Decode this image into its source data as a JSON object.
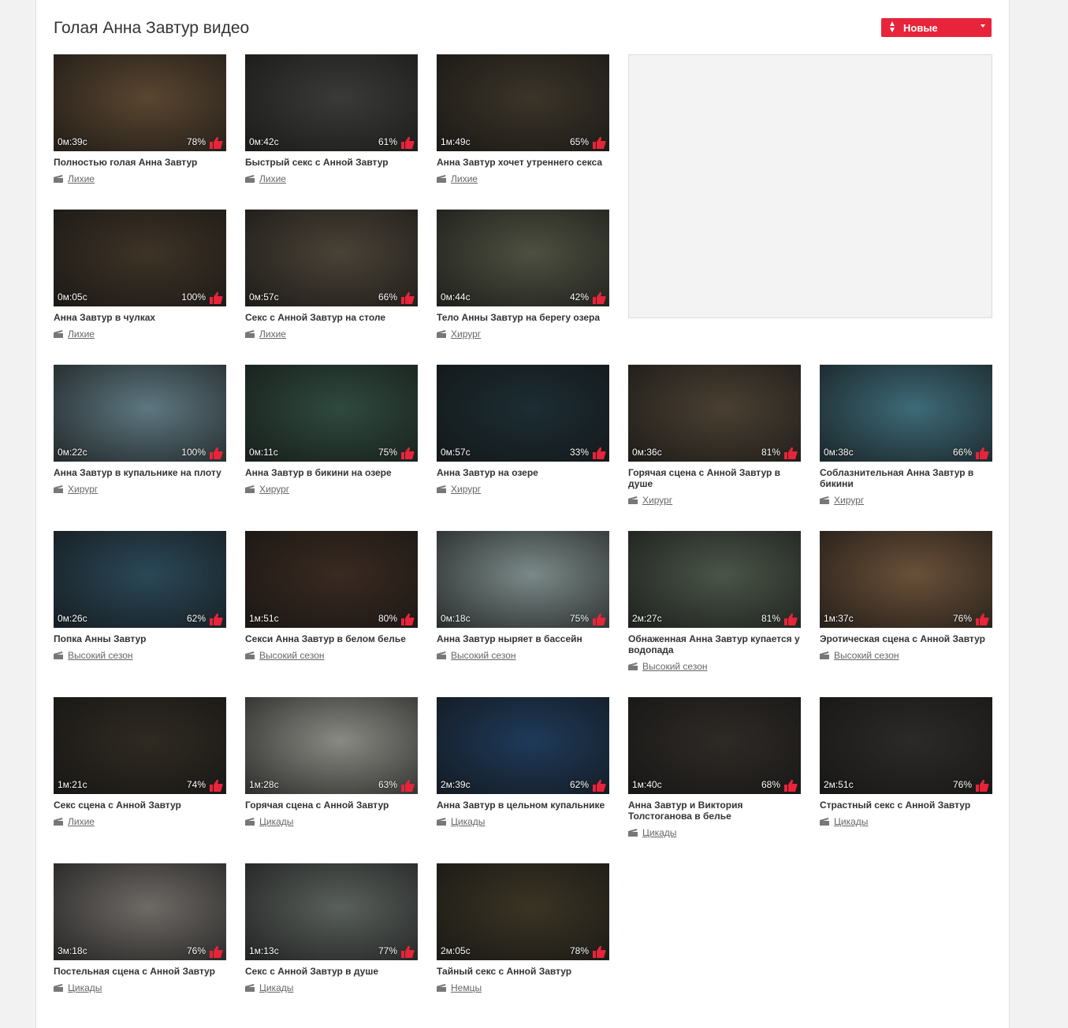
{
  "header": {
    "title": "Голая Анна Завтур видео",
    "sort_label": "Новые"
  },
  "colors": {
    "accent": "#e8243a"
  },
  "videos": [
    {
      "duration": "0м:39с",
      "rating": "78%",
      "title": "Полностью голая Анна Завтур",
      "category": "Лихие",
      "thumb_color": "#5a4630"
    },
    {
      "duration": "0м:42с",
      "rating": "61%",
      "title": "Быстрый секс с Анной Завтур",
      "category": "Лихие",
      "thumb_color": "#3a3a38"
    },
    {
      "duration": "1м:49с",
      "rating": "65%",
      "title": "Анна Завтур хочет утреннего секса",
      "category": "Лихие",
      "thumb_color": "#3b3428"
    },
    {
      "duration": "0м:05с",
      "rating": "100%",
      "title": "Анна Завтур в чулках",
      "category": "Лихие",
      "thumb_color": "#3e3326"
    },
    {
      "duration": "0м:57с",
      "rating": "66%",
      "title": "Секс с Анной Завтур на столе",
      "category": "Лихие",
      "thumb_color": "#4a4236"
    },
    {
      "duration": "0м:44с",
      "rating": "42%",
      "title": "Тело Анны Завтур на берегу озера",
      "category": "Хирург",
      "thumb_color": "#4e5040"
    },
    {
      "duration": "0м:22с",
      "rating": "100%",
      "title": "Анна Завтур в купальнике на плоту",
      "category": "Хирург",
      "thumb_color": "#5d7780"
    },
    {
      "duration": "0м:11с",
      "rating": "75%",
      "title": "Анна Завтур в бикини на озере",
      "category": "Хирург",
      "thumb_color": "#2f4a3e"
    },
    {
      "duration": "0м:57с",
      "rating": "33%",
      "title": "Анна Завтур на озере",
      "category": "Хирург",
      "thumb_color": "#1c2d33"
    },
    {
      "duration": "0м:36с",
      "rating": "81%",
      "title": "Горячая сцена с Анной Завтур в душе",
      "category": "Хирург",
      "thumb_color": "#4a4032"
    },
    {
      "duration": "0м:38с",
      "rating": "66%",
      "title": "Соблазнительная Анна Завтур в бикини",
      "category": "Хирург",
      "thumb_color": "#3d6a78"
    },
    {
      "duration": "0м:26с",
      "rating": "62%",
      "title": "Попка Анны Завтур",
      "category": "Высокий сезон",
      "thumb_color": "#2a4858"
    },
    {
      "duration": "1м:51с",
      "rating": "80%",
      "title": "Секси Анна Завтур в белом белье",
      "category": "Высокий сезон",
      "thumb_color": "#3a2a20"
    },
    {
      "duration": "0м:18с",
      "rating": "75%",
      "title": "Анна Завтур ныряет в бассейн",
      "category": "Высокий сезон",
      "thumb_color": "#7a8a88"
    },
    {
      "duration": "2м:27с",
      "rating": "81%",
      "title": "Обнаженная Анна Завтур купается у водопада",
      "category": "Высокий сезон",
      "thumb_color": "#4a5548"
    },
    {
      "duration": "1м:37с",
      "rating": "76%",
      "title": "Эротическая сцена с Анной Завтур",
      "category": "Высокий сезон",
      "thumb_color": "#6a5038"
    },
    {
      "duration": "1м:21с",
      "rating": "74%",
      "title": "Секс сцена с Анной Завтур",
      "category": "Лихие",
      "thumb_color": "#2f2a22"
    },
    {
      "duration": "1м:28с",
      "rating": "63%",
      "title": "Горячая сцена с Анной Завтур",
      "category": "Цикады",
      "thumb_color": "#8a8a84"
    },
    {
      "duration": "2м:39с",
      "rating": "62%",
      "title": "Анна Завтур в цельном купальнике",
      "category": "Цикады",
      "thumb_color": "#1e3a5a"
    },
    {
      "duration": "1м:40с",
      "rating": "68%",
      "title": "Анна Завтур и Виктория Толстоганова в белье",
      "category": "Цикады",
      "thumb_color": "#2e2a26"
    },
    {
      "duration": "2м:51с",
      "rating": "76%",
      "title": "Страстный секс с Анной Завтур",
      "category": "Цикады",
      "thumb_color": "#2c2a28"
    },
    {
      "duration": "3м:18с",
      "rating": "76%",
      "title": "Постельная сцена с Анной Завтур",
      "category": "Цикады",
      "thumb_color": "#6e6a66"
    },
    {
      "duration": "1м:13с",
      "rating": "77%",
      "title": "Секс с Анной Завтур в душе",
      "category": "Цикады",
      "thumb_color": "#5a605c"
    },
    {
      "duration": "2м:05с",
      "rating": "78%",
      "title": "Тайный секс с Анной Завтур",
      "category": "Немцы",
      "thumb_color": "#3a3424"
    }
  ]
}
